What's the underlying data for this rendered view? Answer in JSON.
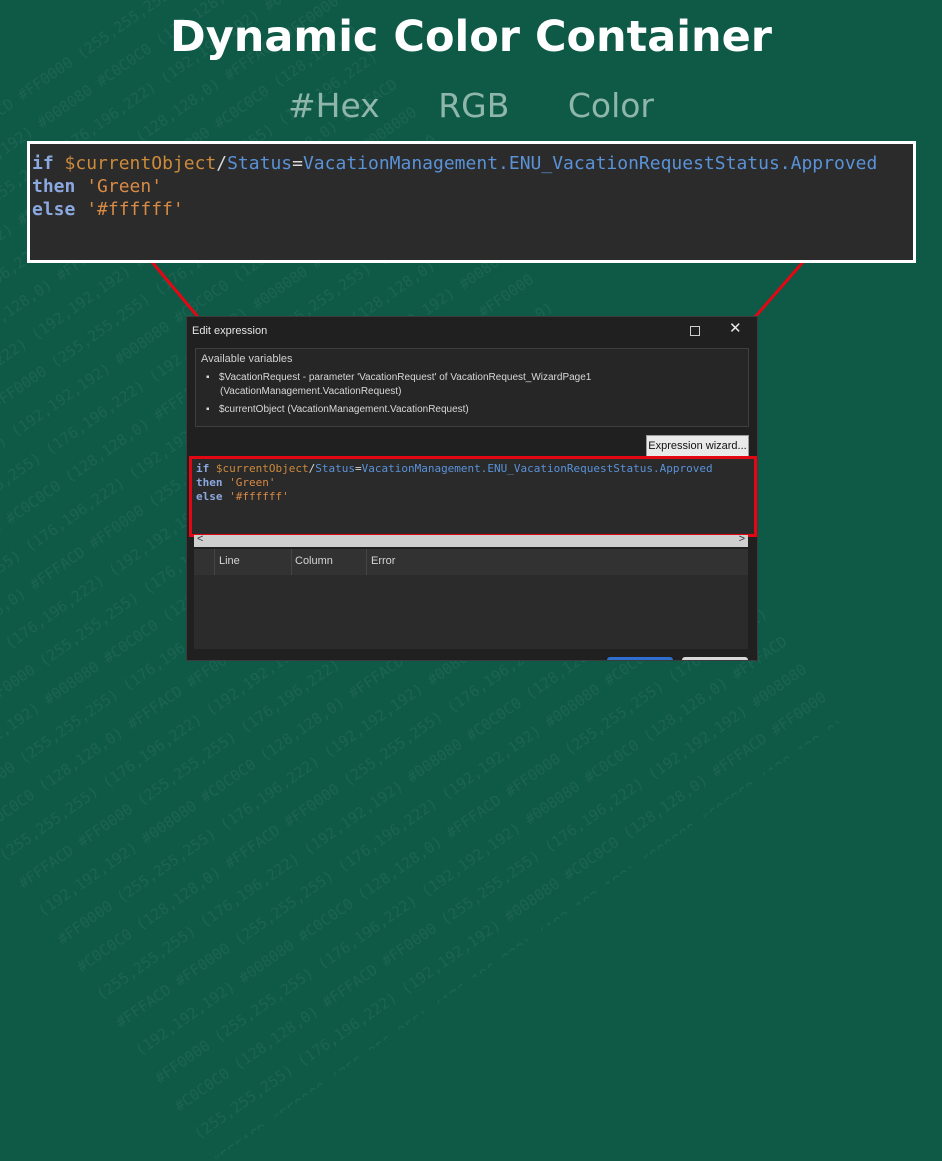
{
  "background_pattern": [
    "(192,192,192) #008080 #C0C0C0 (128,128,0) #FFFACD #FF0000 (255,255,255) (176,196,222)",
    "#FF0000 (255,255,255) (176,196,222) (192,192,192) #008080 #C0C0C0 (128,128,0) #FFFACD",
    "#C0C0C0 (128,128,0) #FFFACD #FF0000 (255,255,255) (176,196,222) (192,192,192) #008080",
    "(255,255,255) (176,196,222) (192,192,192) #008080 #C0C0C0 (128,128,0) #FFFACD #FF0000",
    "#FFFACD #FF0000 (255,255,255) (176,196,222) (192,192,192) #008080 #C0C0C0 (128,128,0)",
    "(192,192,192) #008080 #C0C0C0 (128,128,0) #FFFACD #FF0000 (255,255,255) (176,196,222)",
    "#FF0000 (255,255,255) (176,196,222) (192,192,192) #008080 #C0C0C0 (128,128,0) #FFFACD",
    "#C0C0C0 (128,128,0) #FFFACD #FF0000 (255,255,255) (176,196,222) (192,192,192) #008080",
    "(255,255,255) (176,196,222) (192,192,192) #008080 #C0C0C0 (128,128,0) #FFFACD #FF0000",
    "#FFFACD #FF0000 (255,255,255) (176,196,222) (192,192,192) #008080 #C0C0C0 (128,128,0)",
    "(192,192,192) #008080 #C0C0C0 (128,128,0) #FFFACD #FF0000 (255,255,255) (176,196,222)",
    "#FF0000 (255,255,255) (176,196,222) (192,192,192) #008080 #C0C0C0 (128,128,0) #FFFACD",
    "#C0C0C0 (128,128,0) #FFFACD #FF0000 (255,255,255) (176,196,222) (192,192,192) #008080",
    "(255,255,255) (176,196,222) (192,192,192) #008080 #C0C0C0 (128,128,0) #FFFACD #FF0000",
    "#FFFACD #FF0000 (255,255,255) (176,196,222) (192,192,192) #008080 #C0C0C0 (128,128,0)",
    "(192,192,192) #008080 #C0C0C0 (128,128,0) #FFFACD #FF0000 (255,255,255) (176,196,222)",
    "#FF0000 (255,255,255) (176,196,222) (192,192,192) #008080 #C0C0C0 (128,128,0) #FFFACD",
    "#C0C0C0 (128,128,0) #FFFACD #FF0000 (255,255,255) (176,196,222) (192,192,192) #008080",
    "(255,255,255) (176,196,222) (192,192,192) #008080 #C0C0C0 (128,128,0) #FFFACD #FF0000",
    "#FFFACD #FF0000 (255,255,255) (176,196,222) (192,192,192) #008080 #C0C0C0 (128,128,0)",
    "(192,192,192) #008080 #C0C0C0 (128,128,0) #FFFACD #FF0000 (255,255,255) (176,196,222)",
    "#FF0000 (255,255,255) (176,196,222) (192,192,192) #008080 #C0C0C0 (128,128,0) #FFFACD",
    "#C0C0C0 (128,128,0) #FFFACD #FF0000 (255,255,255) (176,196,222) (192,192,192) #008080",
    "(255,255,255) (176,196,222) (192,192,192) #008080 #C0C0C0 (128,128,0) #FFFACD #FF0000",
    "#FFFACD #FF0000 (255,255,255) (176,196,222) (192,192,192) #008080 #C0C0C0 (128,128,0)",
    "(192,192,192) #008080 #C0C0C0 (128,128,0) #FFFACD #FF0000 (255,255,255) (176,196,222)",
    "#FF0000 (255,255,255) (176,196,222) (192,192,192) #008080 #C0C0C0 (128,128,0) #FFFACD",
    "#C0C0C0 (128,128,0) #FFFACD #FF0000 (255,255,255) (176,196,222) (192,192,192) #008080",
    "(255,255,255) (176,196,222) (192,192,192) #008080 #C0C0C0 (128,128,0) #FFFACD #FF0000",
    "#FFFACD #FF0000 (255,255,255) (176,196,222) (192,192,192) #008080 #C0C0C0 (128,128,0)"
  ],
  "header": {
    "title": "Dynamic Color Container",
    "formats": [
      "#Hex",
      "RGB",
      "Color"
    ]
  },
  "code": {
    "line1": {
      "kw": "if",
      "var": "$currentObject",
      "slash": "/",
      "attr": "Status",
      "eq": "=",
      "value": "VacationManagement.ENU_VacationRequestStatus.Approved"
    },
    "line2": {
      "kw": "then",
      "str": "'Green'"
    },
    "line3": {
      "kw": "else",
      "str": "'#ffffff'"
    }
  },
  "dialog": {
    "title": "Edit expression",
    "variables_heading": "Available variables",
    "variables": [
      "$VacationRequest - parameter 'VacationRequest' of VacationRequest_WizardPage1 (VacationManagement.VacationRequest)",
      "$currentObject (VacationManagement.VacationRequest)"
    ],
    "wizard_button": "Expression wizard...",
    "error_columns": [
      "Line",
      "Column",
      "Error"
    ]
  },
  "colors": {
    "background": "#0f5a47",
    "highlight_red": "#e30613",
    "keyword": "#8ca8e0",
    "variable": "#cc8a3b",
    "path": "#5a92d8",
    "string": "#d98a45"
  }
}
